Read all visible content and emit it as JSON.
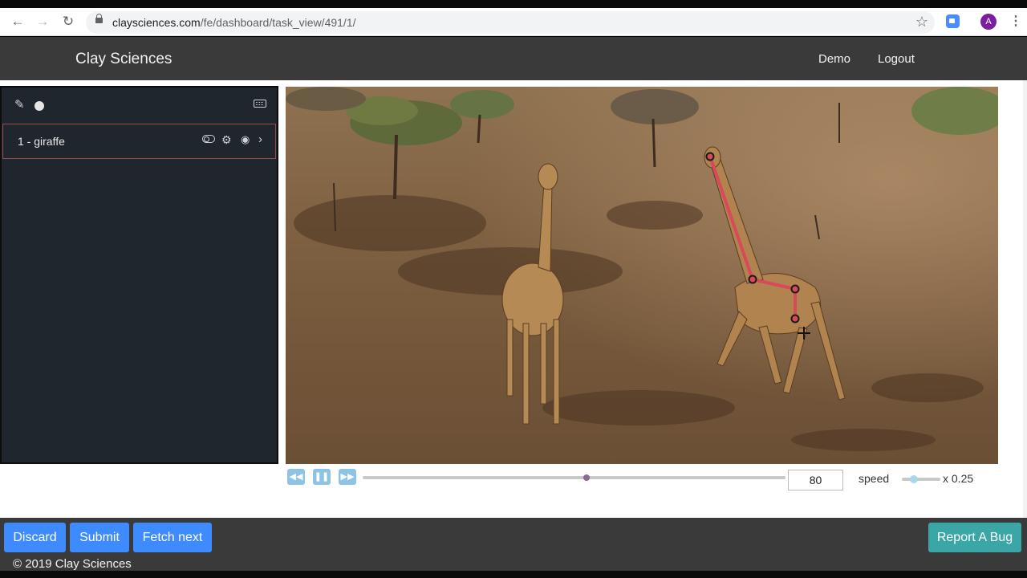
{
  "browser": {
    "url_domain": "claysciences.com",
    "url_path": "/fe/dashboard/task_view/491/1/",
    "avatar_letter": "A"
  },
  "header": {
    "brand": "Clay Sciences",
    "nav": [
      "Demo",
      "Logout"
    ]
  },
  "sidebar": {
    "objects": [
      {
        "label": "1 - giraffe"
      }
    ]
  },
  "playback": {
    "frame": "80",
    "speed_label": "speed",
    "speed_value": "x 0.25",
    "timeline_progress": 0.53,
    "speed_slider_fraction": 0.2
  },
  "annotation": {
    "line_color": "#d9495a",
    "point_color": "#1a1a1a"
  },
  "footer": {
    "buttons": [
      "Discard",
      "Submit",
      "Fetch next"
    ],
    "report_button": "Report A Bug",
    "copyright": "© 2019 Clay Sciences"
  },
  "colors": {
    "primary": "#3d8bff",
    "report": "#3aa6a6",
    "header_bg": "#3a3a3a",
    "sidebar_bg": "#1f262d"
  }
}
